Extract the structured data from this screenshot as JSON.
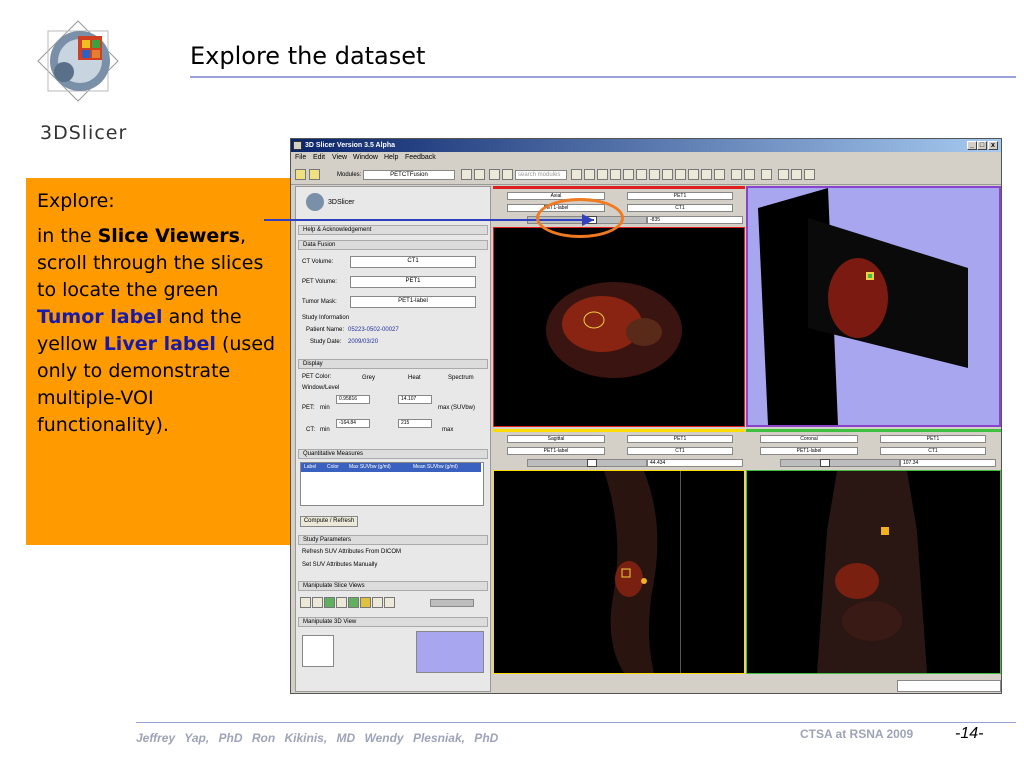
{
  "slide": {
    "title": "Explore the dataset",
    "logo_text": "3DSlicer",
    "footer_authors": "Jeffrey Yap, PhD   Ron Kikinis, MD   Wendy Plesniak, PhD",
    "footer_conference": "CTSA at RSNA 2009",
    "page_number": "-14-"
  },
  "explore": {
    "heading": "Explore:",
    "p1": "in the ",
    "slice_viewers": "Slice Viewers",
    "p2": ", scroll through the slices to locate the green ",
    "tumor_label": "Tumor label",
    "p3": " and the yellow ",
    "liver_label": "Liver label",
    "p4": " (used only to demonstrate multiple-VOI functionality)."
  },
  "app": {
    "window_title": "3D Slicer Version 3.5 Alpha",
    "menus": [
      "File",
      "Edit",
      "View",
      "Window",
      "Help",
      "Feedback"
    ],
    "toolbar": {
      "modules_label": "Modules:",
      "module_value": "PETCTFusion",
      "search_placeholder": "search modules"
    },
    "left_panel": {
      "logo": "3DSlicer",
      "help_section": "Help & Acknowledgement",
      "data_fusion": {
        "header": "Data Fusion",
        "ct_volume_label": "CT Volume:",
        "ct_volume_value": "CT1",
        "pet_volume_label": "PET Volume:",
        "pet_volume_value": "PET1",
        "tumor_mask_label": "Tumor Mask:",
        "tumor_mask_value": "PET1-label",
        "study_info_label": "Study Information",
        "patient_name_label": "Patient Name:",
        "patient_name_value": "05223-0502-00027",
        "study_date_label": "Study Date:",
        "study_date_value": "2009/03/20"
      },
      "display": {
        "header": "Display",
        "pet_color_label": "PET Color:",
        "options": [
          "Grey",
          "Heat",
          "Spectrum"
        ],
        "selected": "Heat",
        "window_level_label": "Window/Level",
        "pet_label": "PET:",
        "min_label": "min",
        "pet_min": "0.95816",
        "pet_max": "14.107",
        "pet_max_label": "max (SUVbw)",
        "ct_label": "CT:",
        "ct_min": "-164.84",
        "ct_max": "215",
        "ct_max_label": "max"
      },
      "quantitative": {
        "header": "Quantitative Measures",
        "columns": [
          "Label",
          "Color",
          "Max SUVbw (g/ml)",
          "Mean SUVbw (g/ml)"
        ],
        "compute_button": "Compute / Refresh"
      },
      "study_params": {
        "header": "Study Parameters",
        "refresh_suv": "Refresh SUV Attributes From DICOM",
        "set_suv": "Set SUV Attributes Manually"
      },
      "manipulate_slice": "Manipulate Slice Views",
      "manipulate_3d": "Manipulate 3D View"
    },
    "viewers": {
      "axial": {
        "orientation": "Axial",
        "fg": "PET1",
        "label": "PET1-label",
        "bg": "CT1",
        "offset": "-835"
      },
      "sagittal": {
        "orientation": "Sagittal",
        "fg": "PET1",
        "label": "PET1-label",
        "bg": "CT1",
        "offset": "44.434"
      },
      "coronal": {
        "orientation": "Coronal",
        "fg": "PET1",
        "label": "PET1-label",
        "bg": "CT1",
        "offset": "107.34"
      }
    },
    "colors": {
      "axial_border": "#e02020",
      "threed_border": "#8844cc",
      "sagittal_border": "#ffdd00",
      "coronal_border": "#40c040",
      "threed_bg": "#a9a6f0"
    }
  }
}
